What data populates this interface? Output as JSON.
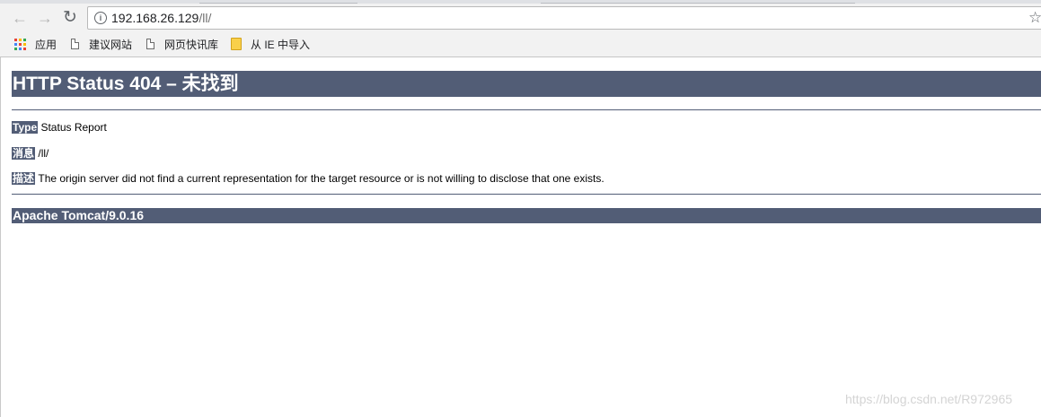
{
  "browser": {
    "url_host": "192.168.26.129",
    "url_path": "/ll/",
    "bookmarks": [
      {
        "label": "应用",
        "icon": "apps-grid-icon"
      },
      {
        "label": "建议网站",
        "icon": "page-icon"
      },
      {
        "label": "网页快讯库",
        "icon": "page-icon"
      },
      {
        "label": "从 IE 中导入",
        "icon": "folder-icon"
      }
    ]
  },
  "page": {
    "heading": "HTTP Status 404 – 未找到",
    "type_label": "Type",
    "type_value": "Status Report",
    "message_label": "消息",
    "message_value": "/ll/",
    "description_label": "描述",
    "description_value": "The origin server did not find a current representation for the target resource or is not willing to disclose that one exists.",
    "footer": "Apache Tomcat/9.0.16"
  },
  "watermark": "https://blog.csdn.net/R972965",
  "colors": {
    "tomcat_bar": "#525d76",
    "chrome_bg": "#f2f2f2"
  }
}
